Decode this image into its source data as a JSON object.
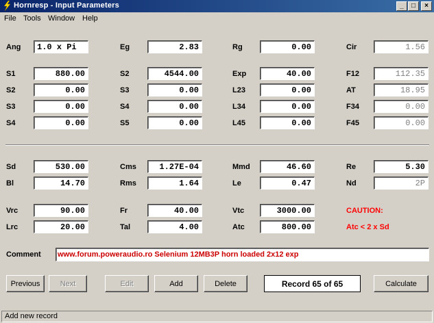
{
  "window": {
    "title": "Hornresp - Input Parameters",
    "minimize_glyph": "_",
    "maximize_glyph": "□",
    "close_glyph": "×",
    "titlebar_color": "#0a246a"
  },
  "menu": [
    "File",
    "Tools",
    "Window",
    "Help"
  ],
  "params": {
    "col1": [
      {
        "label": "Ang",
        "value": "1.0 x Pi"
      },
      {
        "label": "S1",
        "value": "880.00"
      },
      {
        "label": "S2",
        "value": "0.00"
      },
      {
        "label": "S3",
        "value": "0.00"
      },
      {
        "label": "S4",
        "value": "0.00"
      }
    ],
    "col2": [
      {
        "label": "Eg",
        "value": "2.83"
      },
      {
        "label": "S2",
        "value": "4544.00"
      },
      {
        "label": "S3",
        "value": "0.00"
      },
      {
        "label": "S4",
        "value": "0.00"
      },
      {
        "label": "S5",
        "value": "0.00"
      }
    ],
    "col3": [
      {
        "label": "Rg",
        "value": "0.00"
      },
      {
        "label": "Exp",
        "value": "40.00"
      },
      {
        "label": "L23",
        "value": "0.00"
      },
      {
        "label": "L34",
        "value": "0.00"
      },
      {
        "label": "L45",
        "value": "0.00"
      }
    ],
    "col4": [
      {
        "label": "Cir",
        "value": "1.56"
      },
      {
        "label": "F12",
        "value": "112.35"
      },
      {
        "label": "AT",
        "value": "18.95"
      },
      {
        "label": "F34",
        "value": "0.00"
      },
      {
        "label": "F45",
        "value": "0.00"
      }
    ]
  },
  "driver": {
    "col1": [
      {
        "label": "Sd",
        "value": "530.00"
      },
      {
        "label": "Bl",
        "value": "14.70"
      },
      {
        "label": "Vrc",
        "value": "90.00"
      },
      {
        "label": "Lrc",
        "value": "20.00"
      }
    ],
    "col2": [
      {
        "label": "Cms",
        "value": "1.27E-04"
      },
      {
        "label": "Rms",
        "value": "1.64"
      },
      {
        "label": "Fr",
        "value": "40.00"
      },
      {
        "label": "Tal",
        "value": "4.00"
      }
    ],
    "col3": [
      {
        "label": "Mmd",
        "value": "46.60"
      },
      {
        "label": "Le",
        "value": "0.47"
      },
      {
        "label": "Vtc",
        "value": "3000.00"
      },
      {
        "label": "Atc",
        "value": "800.00"
      }
    ],
    "col4": [
      {
        "label": "Re",
        "value": "5.30"
      },
      {
        "label": "Nd",
        "value": "2P"
      }
    ]
  },
  "caution": {
    "title": "CAUTION:",
    "message": "Atc < 2 x Sd",
    "color": "#ff0000"
  },
  "comment": {
    "label": "Comment",
    "value": "www.forum.poweraudio.ro Selenium 12MB3P horn loaded 2x12 exp",
    "color": "#cc0000"
  },
  "buttons": {
    "previous": "Previous",
    "next": "Next",
    "edit": "Edit",
    "add": "Add",
    "delete": "Delete",
    "calculate": "Calculate"
  },
  "record": "Record 65 of 65",
  "status": "Add new record"
}
